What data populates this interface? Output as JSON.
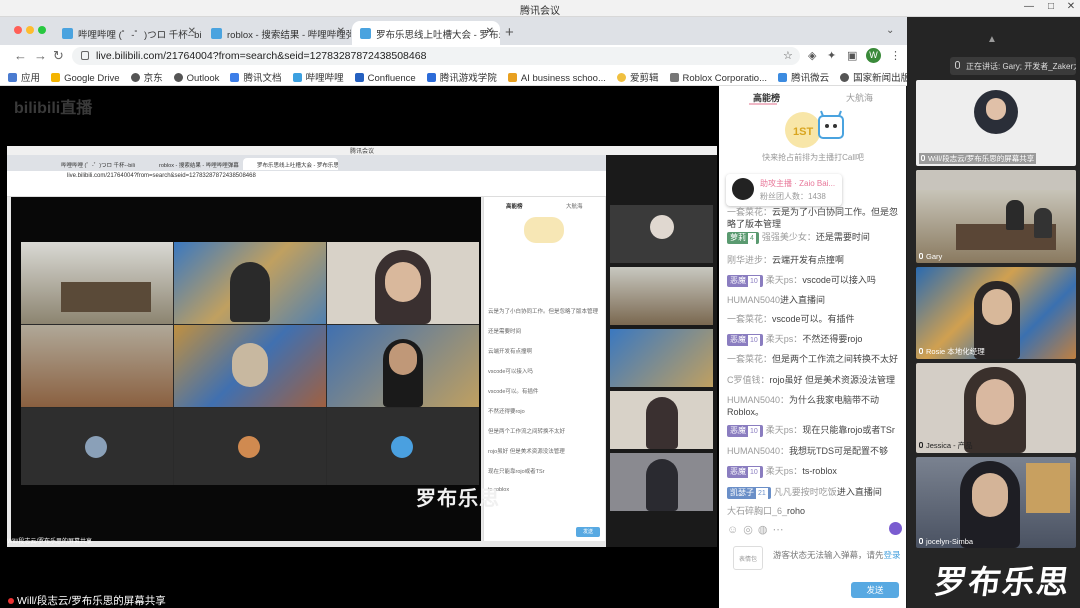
{
  "meeting": {
    "title": "腾讯会议",
    "speaking_label": "正在讲话: Gary; 开发者_Zaker大"
  },
  "browser": {
    "tabs": [
      {
        "label": "哔哩哔哩 (゜-゜)つロ 千杯--bili",
        "active": false
      },
      {
        "label": "roblox - 搜索结果 - 哔哩哔哩弹幕",
        "active": false
      },
      {
        "label": "罗布乐思线上吐槽大会 - 罗布乐思",
        "active": true
      }
    ],
    "url": "live.bilibili.com/21764004?from=search&seid=12783287872438508468",
    "avatar_letter": "W",
    "bookmarks": [
      "应用",
      "Google Drive",
      "京东",
      "Outlook",
      "腾讯文档",
      "哔哩哔哩",
      "Confluence",
      "腾讯游戏学院",
      "AI business schoo...",
      "爱剪辑",
      "Roblox Corporatio...",
      "腾讯微云",
      "国家新闻出版署-进..."
    ]
  },
  "stream": {
    "logo": "bilibili直播",
    "share_caption": "Will/段志云/罗布乐思的屏幕共享",
    "inner_caption": "Will/段志云/罗布乐思的屏幕共享",
    "inner_watermark": "罗布乐思",
    "inner_labels": [
      "Jessica - 产品",
      "Rosie - 产品",
      "Jiahua",
      "Gary",
      "Dev"
    ]
  },
  "chat": {
    "tab_rank": "高能榜",
    "tab_guard": "大航海",
    "callout": "快来抢占前排为主播打Call吧",
    "pinned_name": "助攻主播 · Zaio Bai...",
    "pinned_count": "粉丝团人数：1438",
    "messages": [
      {
        "name": "一套菜花：",
        "text": "云是为了小白协同工作。但是忽略了版本管理",
        "badge": null
      },
      {
        "name": "强强美少女：",
        "text": "还是需要时间",
        "badge": {
          "label": "萝莉",
          "level": "4",
          "color": "green"
        }
      },
      {
        "name": "刚华进步：",
        "text": "云端开发有点撞啊",
        "badge": null
      },
      {
        "name": "柔天ps：",
        "text": "vscode可以接入吗",
        "badge": {
          "label": "恶魔",
          "level": "10",
          "color": "purple"
        }
      },
      {
        "name": "HUMAN5040",
        "text": "进入直播间",
        "badge": null
      },
      {
        "name": "一套菜花：",
        "text": "vscode可以。有插件",
        "badge": null
      },
      {
        "name": "柔天ps：",
        "text": "不然还得要rojo",
        "badge": {
          "label": "恶魔",
          "level": "10",
          "color": "purple"
        }
      },
      {
        "name": "一套菜花：",
        "text": "但是两个工作流之间转换不太好",
        "badge": null
      },
      {
        "name": "C罗值钱：",
        "text": "rojo虽好 但是美术资源没法管理",
        "badge": null
      },
      {
        "name": "HUMAN5040：",
        "text": "为什么我家电脑带不动Roblox。",
        "badge": null
      },
      {
        "name": "柔天ps：",
        "text": "现在只能靠rojo或者TSr",
        "badge": {
          "label": "恶魔",
          "level": "10",
          "color": "purple"
        }
      },
      {
        "name": "HUMAN5040：",
        "text": "我想玩TDS可是配置不够",
        "badge": null
      },
      {
        "name": "柔天ps：",
        "text": "ts-roblox",
        "badge": {
          "label": "恶魔",
          "level": "10",
          "color": "purple"
        }
      },
      {
        "name": "凡凡要按时吃饭",
        "text": "进入直播间",
        "badge": {
          "label": "凯瑟子",
          "level": "21",
          "color": "blue"
        }
      },
      {
        "name": "大石碎胸口_6_",
        "text": "roho",
        "badge": null
      }
    ],
    "input_mic": "表情包",
    "input_hint": "游客状态无法输入弹幕，请先",
    "input_login": "登录",
    "send": "发送"
  },
  "participants": [
    {
      "name": "Will/段志云/罗布乐思的屏幕共享",
      "type": "man"
    },
    {
      "name": "Gary",
      "type": "office"
    },
    {
      "name": "Rosie 本地化经理",
      "type": "robots"
    },
    {
      "name": "Jessica - 产品",
      "type": "woman"
    },
    {
      "name": "jocelyn-Simba",
      "type": "woman2"
    }
  ],
  "watermark": "罗布乐思",
  "colors": {
    "accent": "#58a9e2",
    "pink": "#e8789a",
    "badge_purple": "#8a7dc0",
    "badge_green": "#5a9a70"
  }
}
